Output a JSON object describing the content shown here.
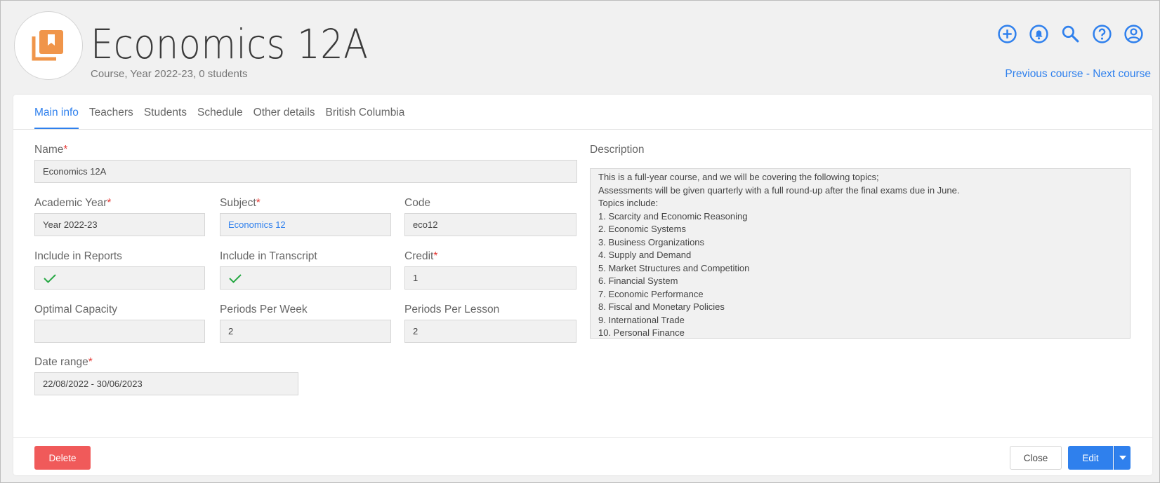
{
  "header": {
    "title": "Economics 12A",
    "subtitle": "Course, Year 2022-23, 0 students",
    "icons": [
      "add-icon",
      "bell-icon",
      "search-icon",
      "help-icon",
      "account-icon"
    ],
    "prev_label": "Previous course",
    "separator": " - ",
    "next_label": "Next course",
    "accent": "#2f80ed",
    "logo_color": "#f0954a"
  },
  "tabs": [
    {
      "label": "Main info",
      "active": true
    },
    {
      "label": "Teachers"
    },
    {
      "label": "Students"
    },
    {
      "label": "Schedule"
    },
    {
      "label": "Other details"
    },
    {
      "label": "British Columbia"
    }
  ],
  "form": {
    "name": {
      "label": "Name",
      "value": "Economics 12A"
    },
    "academic_year": {
      "label": "Academic Year",
      "value": "Year 2022-23"
    },
    "subject": {
      "label": "Subject",
      "value": "Economics 12"
    },
    "code": {
      "label": "Code",
      "value": "eco12"
    },
    "include_reports": {
      "label": "Include in Reports",
      "checked": true
    },
    "include_transcript": {
      "label": "Include in Transcript",
      "checked": true
    },
    "credit": {
      "label": "Credit",
      "value": "1"
    },
    "optimal_capacity": {
      "label": "Optimal Capacity",
      "value": ""
    },
    "periods_week": {
      "label": "Periods Per Week",
      "value": "2"
    },
    "periods_lesson": {
      "label": "Periods Per Lesson",
      "value": "2"
    },
    "date_range": {
      "label": "Date range",
      "value": "22/08/2022 - 30/06/2023"
    },
    "required_mark": "*"
  },
  "description": {
    "label": "Description",
    "lines": [
      "This is a full-year course, and we will be covering the following topics;",
      "Assessments will be given quarterly with a full round-up after the final exams due in June.",
      "Topics include:",
      "1. Scarcity and Economic Reasoning",
      "2. Economic Systems",
      "3. Business Organizations",
      "4. Supply and Demand",
      "5. Market Structures and Competition",
      "6. Financial System",
      "7. Economic Performance",
      "8. Fiscal and Monetary Policies",
      "9. International Trade",
      "10. Personal Finance"
    ]
  },
  "actions": {
    "delete_label": "Delete",
    "close_label": "Close",
    "edit_label": "Edit",
    "delete_color": "#f05a5a"
  }
}
